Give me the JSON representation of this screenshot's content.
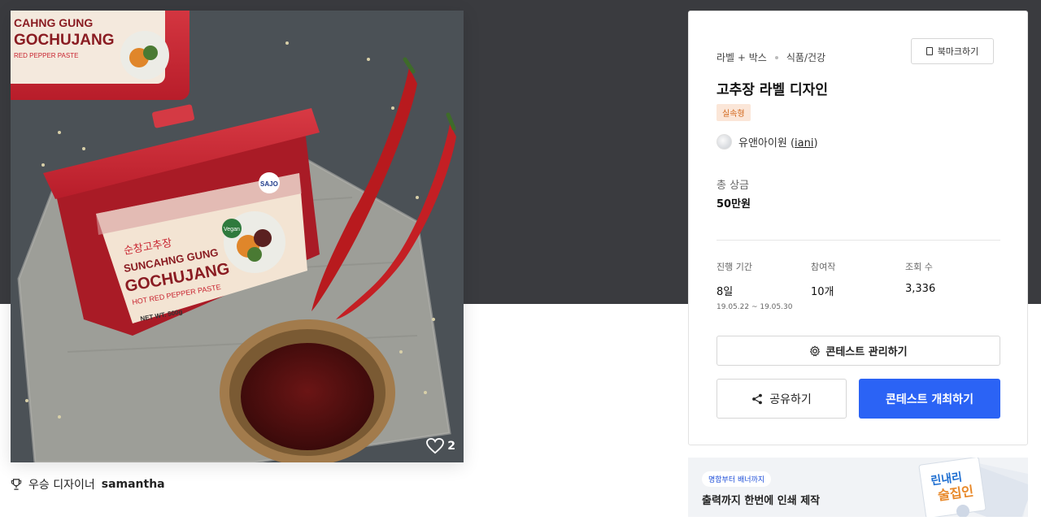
{
  "hero": {
    "like_count": "2",
    "label_brand_line1": "SUNCAHNG GUNG",
    "label_brand_line2": "GOCHUJANG",
    "label_sub": "HOT RED PEPPER PASTE",
    "label_weight": "NET WT. 500g",
    "label_korean": "순창고추장",
    "label_vegan": "Vegan",
    "logo_text": "SAJO",
    "top_brand_line1": "CAHNG GUNG",
    "top_brand_line2": "GOCHUJANG",
    "top_sub": "RED PEPPER PASTE"
  },
  "winner": {
    "prefix": "우승 디자이너",
    "name": "samantha"
  },
  "card": {
    "category": "라벨 + 박스",
    "subcategory": "식품/건강",
    "bookmark_label": "북마크하기",
    "title": "고추장 라벨 디자인",
    "badge": "실속형",
    "owner_name": "유앤아이원",
    "owner_handle": "iani",
    "prize_label": "총 상금",
    "prize_value": "50만원",
    "stats": [
      {
        "label": "진행 기간",
        "value": "8일",
        "sub": "19.05.22 ~ 19.05.30"
      },
      {
        "label": "참여작",
        "value": "10개",
        "sub": ""
      },
      {
        "label": "조회 수",
        "value": "3,336",
        "sub": ""
      }
    ],
    "manage_label": "콘테스트 관리하기",
    "share_label": "공유하기",
    "host_label": "콘테스트 개최하기"
  },
  "ad": {
    "pill": "명함부터 배너까지",
    "headline": "출력까지 한번에 인쇄 제작",
    "art_text_1": "린내리",
    "art_text_2": "술집인"
  },
  "colors": {
    "primary": "#2b63f5",
    "badge_bg": "#fbe6d8",
    "badge_text": "#d2691e",
    "dark_band": "#3a3b3f",
    "tub_red": "#c8232f"
  }
}
